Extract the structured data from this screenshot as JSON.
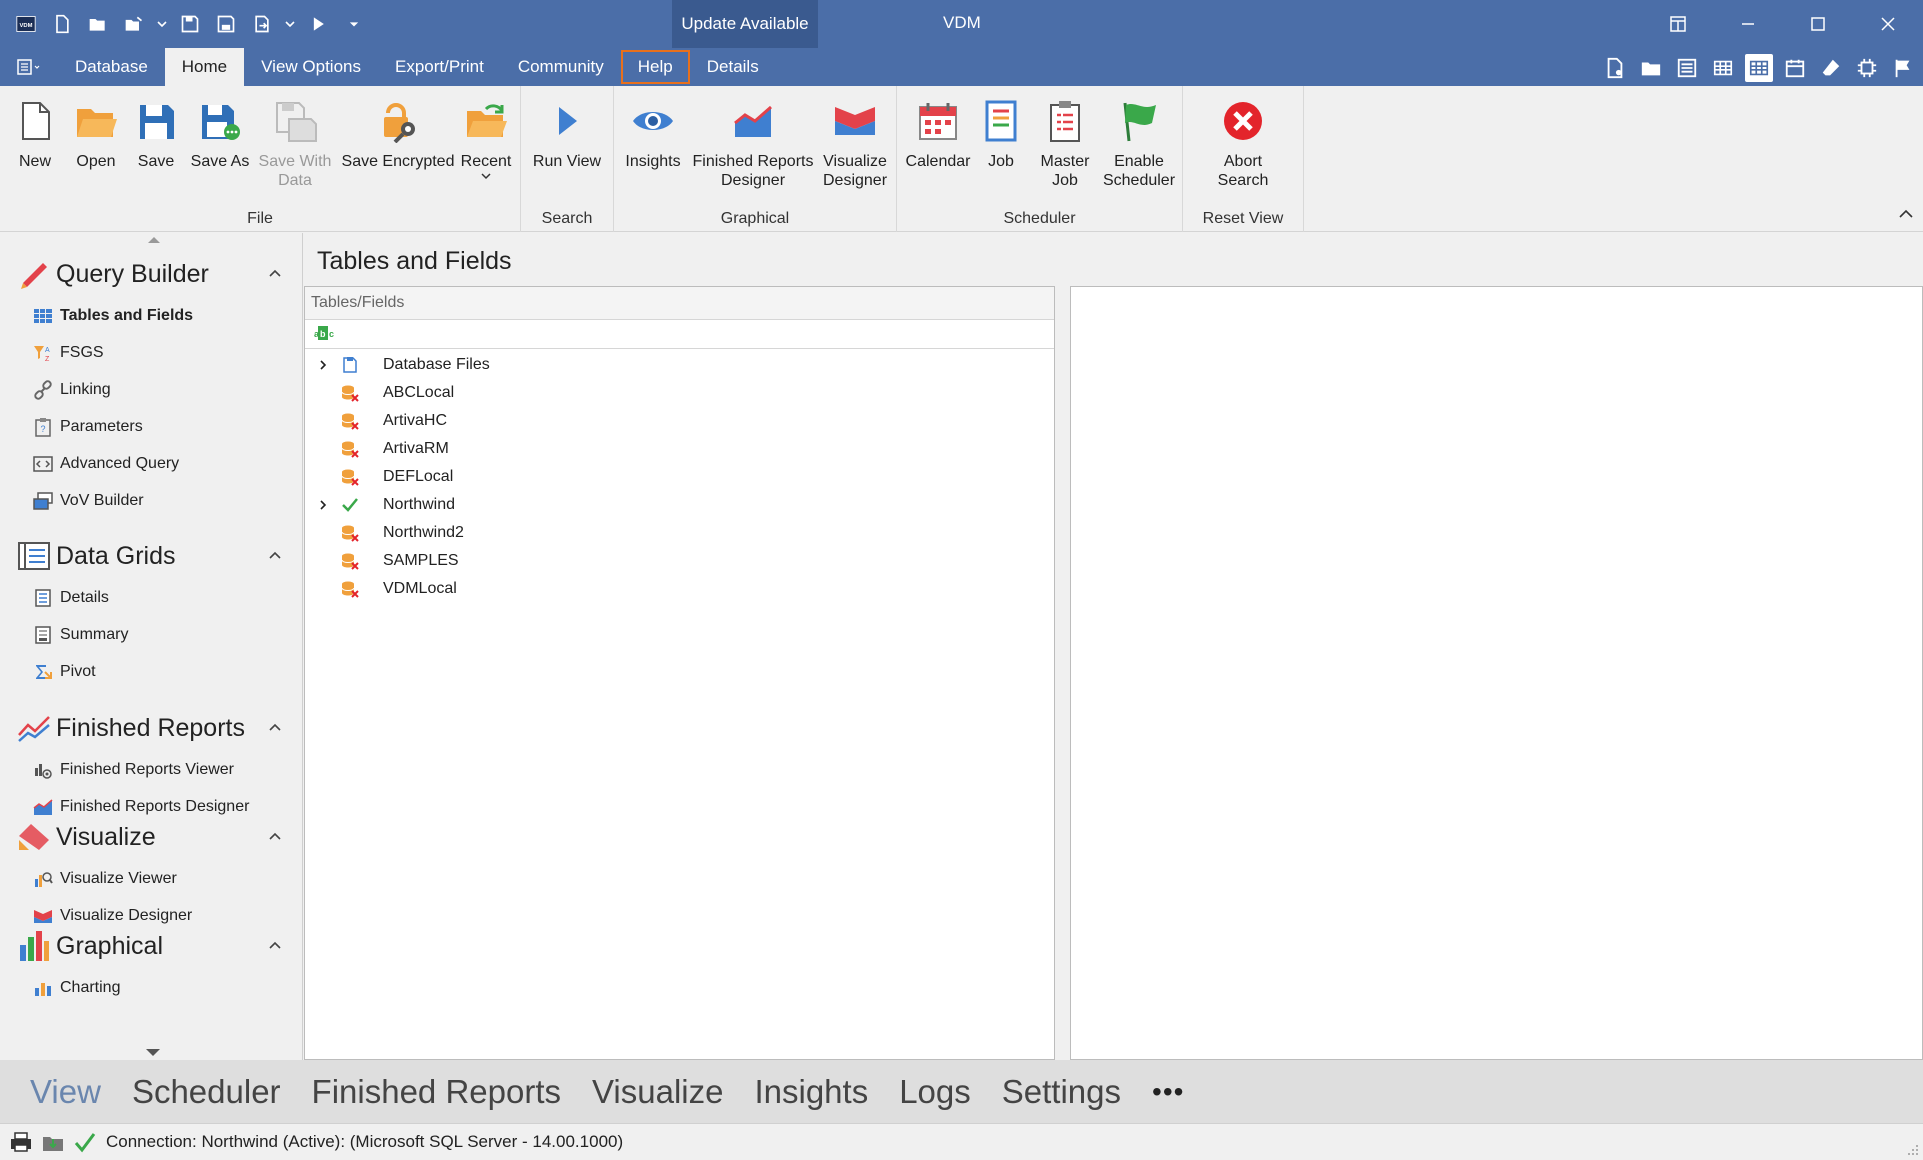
{
  "app": {
    "title": "VDM",
    "update_label": "Update Available",
    "logo_text": "VDM"
  },
  "tabs": [
    {
      "label": "Database"
    },
    {
      "label": "Home"
    },
    {
      "label": "View Options"
    },
    {
      "label": "Export/Print"
    },
    {
      "label": "Community"
    },
    {
      "label": "Help"
    },
    {
      "label": "Details"
    }
  ],
  "ribbon": {
    "groups": {
      "file": "File",
      "search": "Search",
      "graphical": "Graphical",
      "scheduler": "Scheduler",
      "reset_view": "Reset View"
    },
    "buttons": {
      "new": "New",
      "open": "Open",
      "save": "Save",
      "save_as": "Save As",
      "save_with_data_1": "Save With",
      "save_with_data_2": "Data",
      "save_encrypted": "Save Encrypted",
      "recent": "Recent",
      "run_view": "Run View",
      "insights": "Insights",
      "finished_reports_designer_1": "Finished Reports",
      "finished_reports_designer_2": "Designer",
      "visualize_designer_1": "Visualize",
      "visualize_designer_2": "Designer",
      "calendar": "Calendar",
      "job": "Job",
      "master_job_1": "Master",
      "master_job_2": "Job",
      "enable_scheduler_1": "Enable",
      "enable_scheduler_2": "Scheduler",
      "abort_search_1": "Abort",
      "abort_search_2": "Search"
    }
  },
  "nav": {
    "query_builder": {
      "title": "Query Builder",
      "items": [
        "Tables and Fields",
        "FSGS",
        "Linking",
        "Parameters",
        "Advanced Query",
        "VoV Builder"
      ]
    },
    "data_grids": {
      "title": "Data Grids",
      "items": [
        "Details",
        "Summary",
        "Pivot"
      ]
    },
    "finished_reports": {
      "title": "Finished Reports",
      "items": [
        "Finished Reports Viewer",
        "Finished Reports Designer"
      ]
    },
    "visualize": {
      "title": "Visualize",
      "items": [
        "Visualize Viewer",
        "Visualize Designer"
      ]
    },
    "graphical": {
      "title": "Graphical",
      "items": [
        "Charting"
      ]
    }
  },
  "content": {
    "title": "Tables and Fields",
    "panel_header": "Tables/Fields",
    "filter_icon_text": "ABC",
    "tree": [
      {
        "label": "Database Files",
        "expandable": true,
        "status": "file"
      },
      {
        "label": "ABCLocal",
        "expandable": false,
        "status": "error"
      },
      {
        "label": "ArtivaHC",
        "expandable": false,
        "status": "error"
      },
      {
        "label": "ArtivaRM",
        "expandable": false,
        "status": "error"
      },
      {
        "label": "DEFLocal",
        "expandable": false,
        "status": "error"
      },
      {
        "label": "Northwind",
        "expandable": true,
        "status": "ok"
      },
      {
        "label": "Northwind2",
        "expandable": false,
        "status": "error"
      },
      {
        "label": "SAMPLES",
        "expandable": false,
        "status": "error"
      },
      {
        "label": "VDMLocal",
        "expandable": false,
        "status": "error"
      }
    ]
  },
  "bottom_tabs": [
    "View",
    "Scheduler",
    "Finished Reports",
    "Visualize",
    "Insights",
    "Logs",
    "Settings",
    "•••"
  ],
  "status": {
    "connection": "Connection: Northwind (Active): (Microsoft SQL Server - 14.00.1000)"
  },
  "colors": {
    "titlebar": "#4b6ea8",
    "update_bg": "#3a5a8f",
    "help_outline": "#e8701c",
    "active_bottom_tab": "#6a86ae"
  }
}
